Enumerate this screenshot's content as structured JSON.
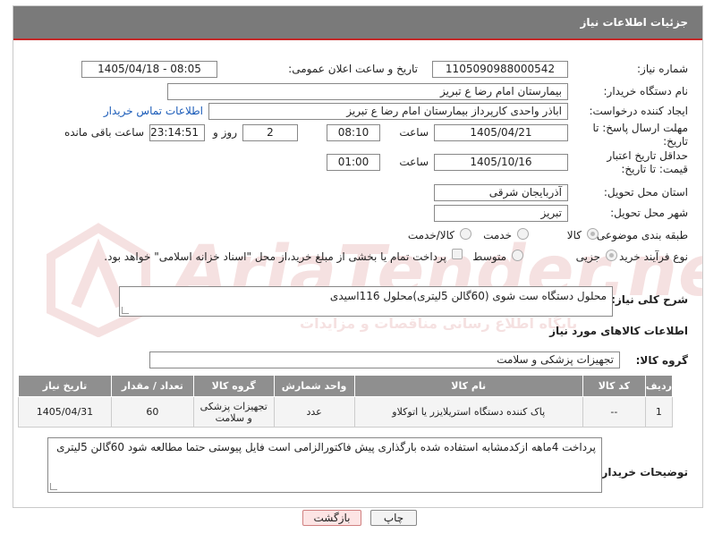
{
  "header": {
    "title": "جزئیات اطلاعات نیاز"
  },
  "fields": {
    "need_number_label": "شماره نیاز:",
    "need_number": "1105090988000542",
    "announce_label": "تاریخ و ساعت اعلان عمومی:",
    "announce_value": "1405/04/18 - 08:05",
    "buyer_org_label": "نام دستگاه خریدار:",
    "buyer_org": "بیمارستان امام رضا  ع  تبریز",
    "creator_label": "ایجاد کننده درخواست:",
    "creator": "اباذر واحدی کارپرداز بیمارستان امام رضا  ع  تبریز",
    "contact_link": "اطلاعات تماس خریدار",
    "deadline_label": "مهلت ارسال پاسخ: تا تاریخ:",
    "deadline_date": "1405/04/21",
    "time_label": "ساعت",
    "deadline_time": "08:10",
    "days_value": "2",
    "days_label": "روز و",
    "remaining_time": "23:14:51",
    "remaining_label": "ساعت باقی مانده",
    "price_validity_label": "حداقل تاریخ اعتبار قیمت: تا تاریخ:",
    "price_validity_date": "1405/10/16",
    "price_validity_time": "01:00",
    "province_label": "استان محل تحویل:",
    "province": "آذربایجان شرقی",
    "city_label": "شهر محل تحویل:",
    "city": "تبریز",
    "category_label": "طبقه بندی موضوعی:",
    "category_options": [
      "کالا",
      "خدمت",
      "کالا/خدمت"
    ],
    "process_label": "نوع فرآیند خرید :",
    "process_options": [
      "جزیی",
      "متوسط"
    ],
    "payment_note": "پرداخت تمام یا بخشی از مبلغ خرید،از محل \"اسناد خزانه اسلامی\" خواهد بود.",
    "summary_label": "شرح کلی نیاز:",
    "summary": "محلول دستگاه ست شوی (60گالن 5لیتری)محلول 116اسیدی",
    "goods_info_title": "اطلاعات کالاهای مورد نیاز",
    "goods_group_label": "گروه کالا:",
    "goods_group": "تجهیزات پزشکی و سلامت",
    "buyer_notes_label": "توضیحات خریدار:",
    "buyer_notes": "پرداخت 4ماهه ازکدمشابه استفاده شده بارگذاری پیش فاکتورالزامی است فایل پیوستی حتما مطالعه شود 60گالن 5لیتری"
  },
  "table": {
    "headers": [
      "ردیف",
      "کد کالا",
      "نام کالا",
      "واحد شمارش",
      "گروه کالا",
      "تعداد / مقدار",
      "تاریخ نیاز"
    ],
    "rows": [
      [
        "1",
        "--",
        "پاک کننده دستگاه استریلایزر یا اتوکلاو",
        "عدد",
        "تجهیزات پزشکی و سلامت",
        "60",
        "1405/04/31"
      ]
    ]
  },
  "buttons": {
    "print": "چاپ",
    "back": "بازگشت"
  },
  "watermark": {
    "text": "AriaTender.neT",
    "sub": "پایگاه اطلاع رسانی مناقصات و مزایدات"
  },
  "colors": {
    "header_bg": "#7a7a7a",
    "accent": "#c62828",
    "link": "#1a5bb8",
    "table_header": "#8f8f8f"
  }
}
